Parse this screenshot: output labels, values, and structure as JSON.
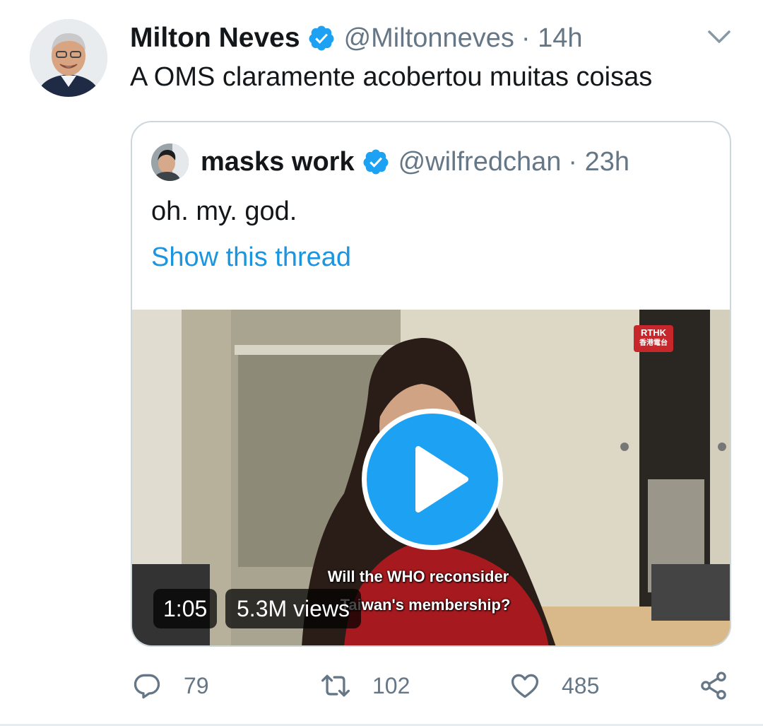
{
  "tweet": {
    "display_name": "Milton Neves",
    "handle": "@Miltonneves",
    "time": "· 14h",
    "text": "A OMS claramente acobertou muitas coisas",
    "avatar_icon": "user-avatar",
    "verified_icon": "verified-badge-icon",
    "menu_icon": "chevron-down-icon"
  },
  "quoted_tweet": {
    "display_name": "masks work",
    "handle": "@wilfredchan",
    "time": "· 23h",
    "text": "oh. my. god.",
    "thread_link": "Show this thread",
    "video": {
      "duration": "1:05",
      "views": "5.3M views",
      "subtitle_line1": "Will the WHO reconsider",
      "subtitle_line2": "Taiwan's membership?",
      "logo_text": "RTHK",
      "logo_subtext": "香港電台",
      "play_icon": "play-icon"
    }
  },
  "actions": {
    "reply_count": "79",
    "retweet_count": "102",
    "like_count": "485",
    "reply_icon": "reply-icon",
    "retweet_icon": "retweet-icon",
    "like_icon": "heart-icon",
    "share_icon": "share-icon"
  },
  "colors": {
    "verified": "#1da1f2",
    "link": "#1b95e0",
    "secondary_text": "#657786",
    "border": "#ccd6dd"
  }
}
